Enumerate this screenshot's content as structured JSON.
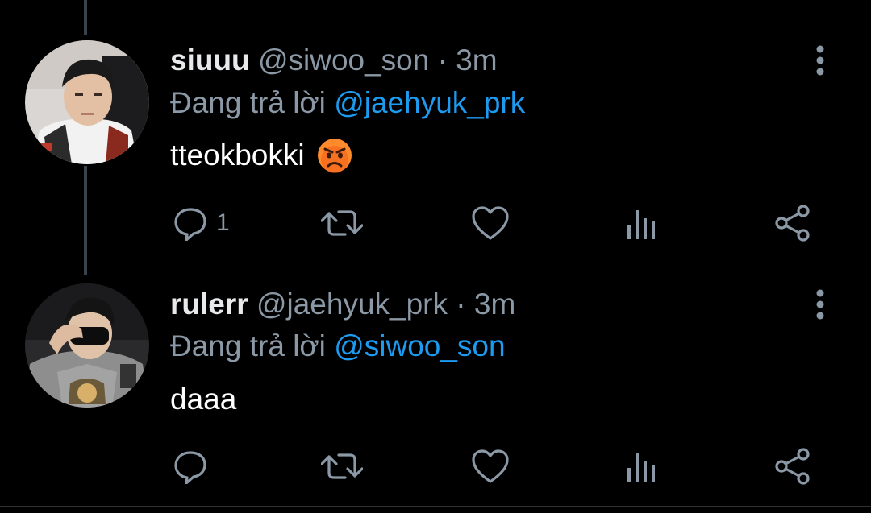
{
  "theme": {
    "background": "#000000",
    "text_primary": "#ffffff",
    "text_secondary": "#8b98a5",
    "mention_color": "#1d9bf0",
    "thread_line": "#38444d"
  },
  "tweets": [
    {
      "display_name": "siuuu",
      "handle": "@siwoo_son",
      "separator": "·",
      "time": "3m",
      "reply_prefix": "Đang trả lời",
      "reply_to": "@jaehyuk_prk",
      "text": "tteokbokki",
      "emoji": "angry-face-emoji",
      "avatar": "user-avatar",
      "actions": {
        "reply_icon": "reply-icon",
        "reply_count": "1",
        "retweet_icon": "retweet-icon",
        "like_icon": "heart-icon",
        "analytics_icon": "analytics-icon",
        "share_icon": "share-icon"
      },
      "more_icon": "more-vertical-icon"
    },
    {
      "display_name": "rulerr",
      "handle": "@jaehyuk_prk",
      "separator": "·",
      "time": "3m",
      "reply_prefix": "Đang trả lời",
      "reply_to": "@siwoo_son",
      "text": "daaa",
      "avatar": "user-avatar",
      "actions": {
        "reply_icon": "reply-icon",
        "reply_count": "",
        "retweet_icon": "retweet-icon",
        "like_icon": "heart-icon",
        "analytics_icon": "analytics-icon",
        "share_icon": "share-icon"
      },
      "more_icon": "more-vertical-icon"
    }
  ]
}
